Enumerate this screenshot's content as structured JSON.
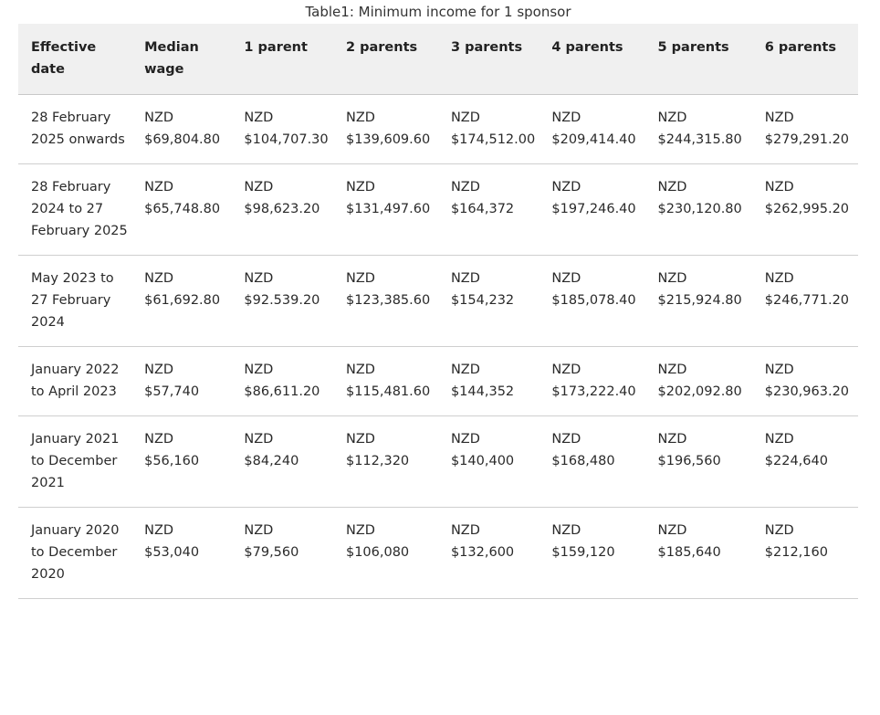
{
  "caption": "Table1: Minimum income for 1 sponsor",
  "table": {
    "headers": [
      "Effective date",
      "Median wage",
      "1 parent",
      "2 parents",
      "3 parents",
      "4 parents",
      "5 parents",
      "6 parents"
    ],
    "currency": "NZD",
    "rows": [
      {
        "date": "28 February 2025 onwards",
        "values": [
          "$69,804.80",
          "$104,707.30",
          "$139,609.60",
          "$174,512.00",
          "$209,414.40",
          "$244,315.80",
          "$279,291.20"
        ]
      },
      {
        "date": "28 February 2024 to 27 February 2025",
        "values": [
          "$65,748.80",
          "$98,623.20",
          "$131,497.60",
          "$164,372",
          "$197,246.40",
          "$230,120.80",
          "$262,995.20"
        ]
      },
      {
        "date": "May 2023 to 27 February 2024",
        "values": [
          "$61,692.80",
          "$92.539.20",
          "$123,385.60",
          "$154,232",
          "$185,078.40",
          "$215,924.80",
          "$246,771.20"
        ]
      },
      {
        "date": "January 2022 to April 2023",
        "values": [
          "$57,740",
          "$86,611.20",
          "$115,481.60",
          "$144,352",
          "$173,222.40",
          "$202,092.80",
          "$230,963.20"
        ]
      },
      {
        "date": "January 2021 to December 2021",
        "values": [
          "$56,160",
          "$84,240",
          "$112,320",
          "$140,400",
          "$168,480",
          "$196,560",
          "$224,640"
        ]
      },
      {
        "date": "January 2020 to December 2020",
        "values": [
          "$53,040",
          "$79,560",
          "$106,080",
          "$132,600",
          "$159,120",
          "$185,640",
          "$212,160"
        ]
      }
    ]
  }
}
